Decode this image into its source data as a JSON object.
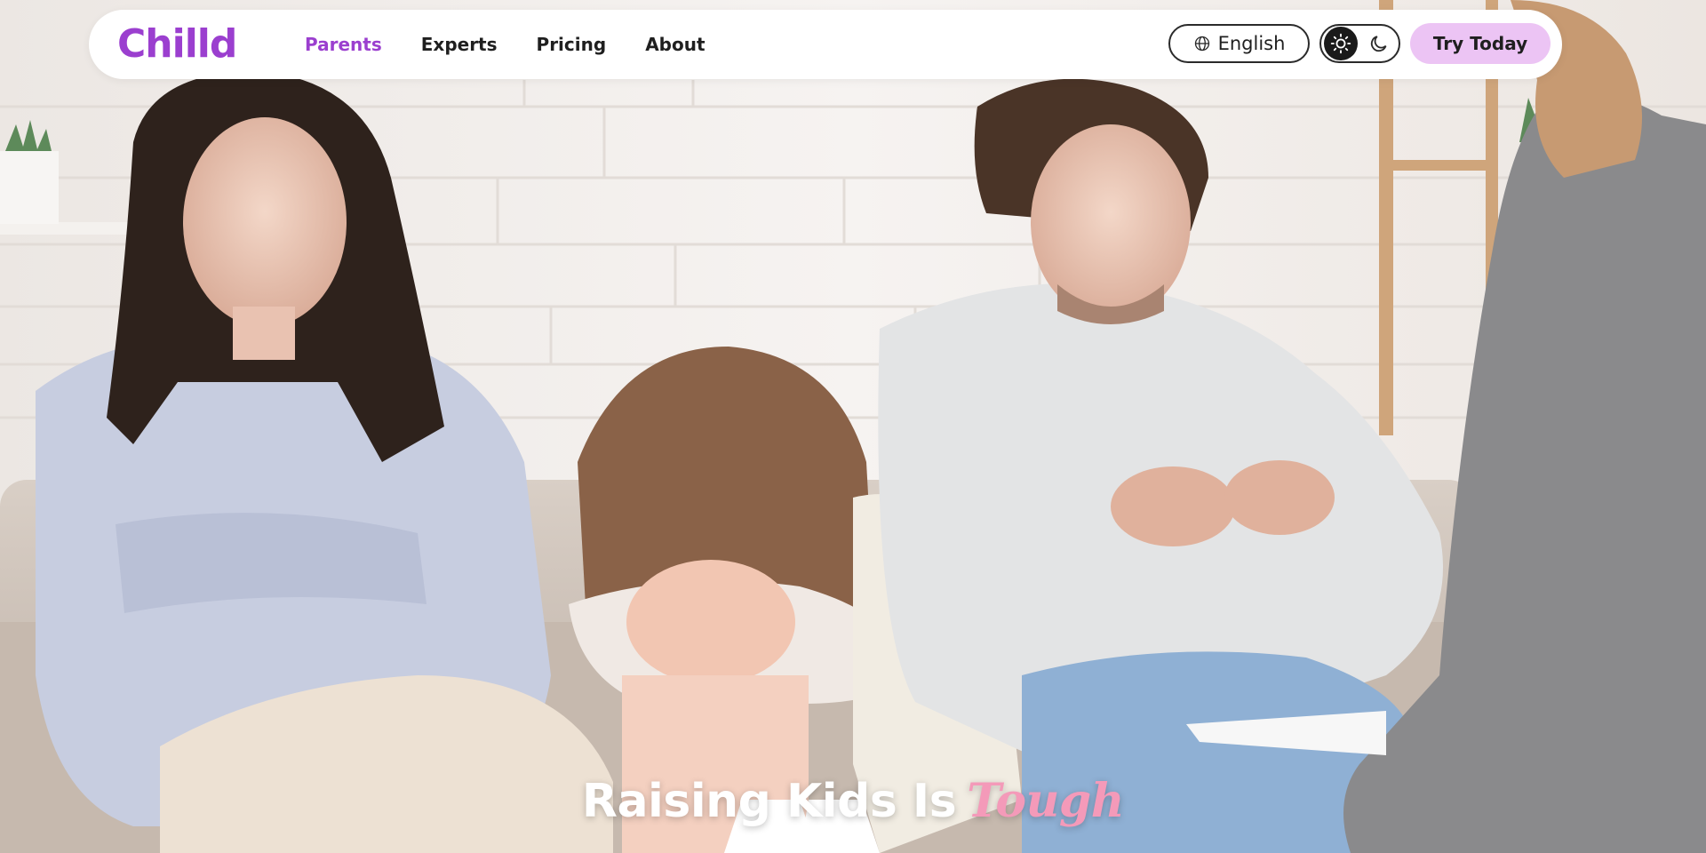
{
  "brand": {
    "logo_text": "Chilld",
    "color": "#9b3fcf"
  },
  "nav": {
    "links": [
      {
        "label": "Parents",
        "active": true
      },
      {
        "label": "Experts",
        "active": false
      },
      {
        "label": "Pricing",
        "active": false
      },
      {
        "label": "About",
        "active": false
      }
    ],
    "active_color": "#9b3fcf"
  },
  "language": {
    "label": "English",
    "icon": "globe-icon"
  },
  "theme_toggle": {
    "selected": "light",
    "options": [
      "sun-icon",
      "moon-icon"
    ]
  },
  "cta": {
    "label": "Try Today",
    "background": "#ecc4f4"
  },
  "hero": {
    "headline_main": "Raising Kids Is",
    "headline_accent": "Tough",
    "accent_color": "#f49ab9"
  }
}
